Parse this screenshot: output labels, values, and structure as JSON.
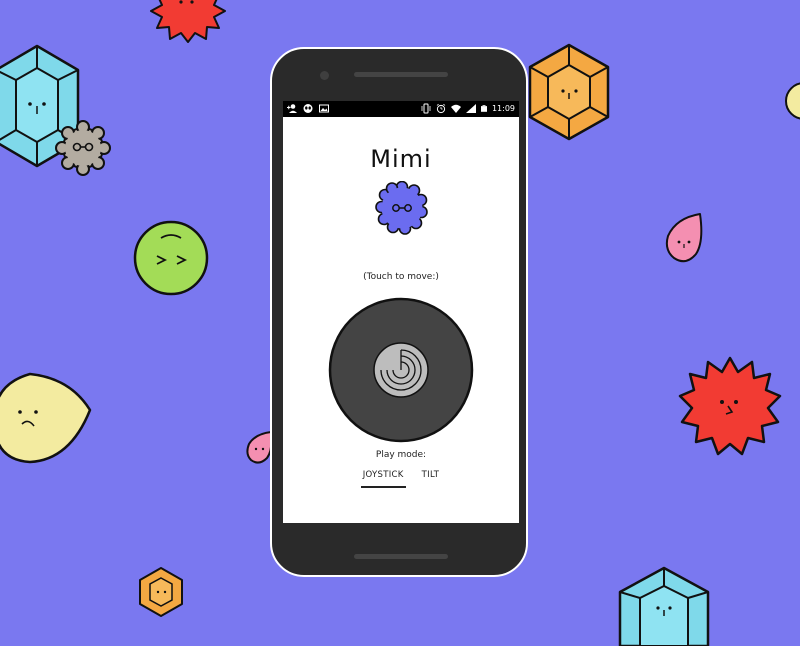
{
  "app": {
    "title": "Mimi",
    "touch_hint": "(Touch to move:)",
    "play_mode_label": "Play mode:",
    "tabs": [
      {
        "label": "JOYSTICK",
        "active": true
      },
      {
        "label": "TILT",
        "active": false
      }
    ]
  },
  "status_bar": {
    "time": "11:09",
    "left_icons": [
      "person-add-icon",
      "alien-icon",
      "image-icon"
    ],
    "right_icons": [
      "vibrate-icon",
      "alarm-icon",
      "wifi-icon",
      "signal-icon",
      "battery-icon"
    ]
  },
  "colors": {
    "background": "#7a78f0",
    "avatar": "#6b6cf0",
    "joystick_base": "#444444",
    "joystick_knob": "#bdbdbd",
    "gem_blue": "#7fd9ea",
    "gem_orange": "#f4a842",
    "gem_red": "#f23b33",
    "green": "#a3dc57",
    "yellow": "#f3eba0",
    "pink": "#f48fb1",
    "gray": "#b3aca1"
  }
}
